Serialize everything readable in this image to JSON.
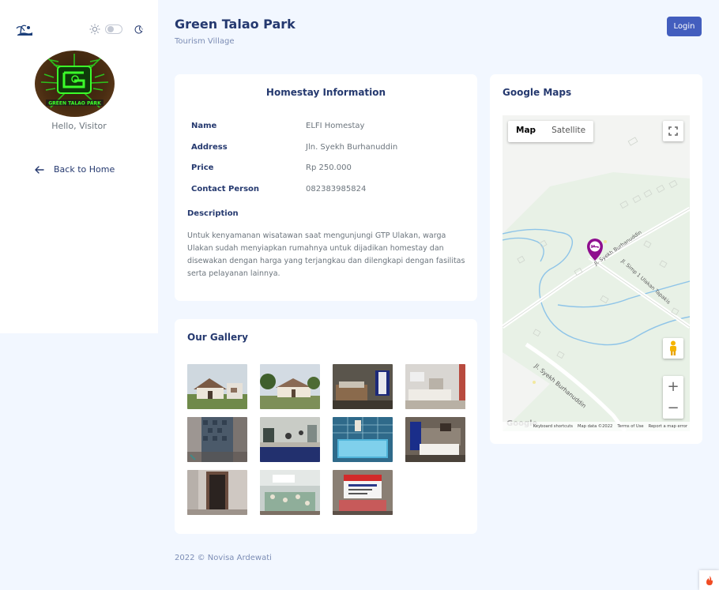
{
  "sidebar": {
    "hello_text": "Hello, Visitor",
    "back_label": "Back to Home",
    "logo_text": "GREEN TALAO PARK"
  },
  "header": {
    "title": "Green Talao Park",
    "subtitle": "Tourism Village",
    "login_label": "Login"
  },
  "homestay": {
    "card_title": "Homestay Information",
    "rows": [
      {
        "key": "Name",
        "value": "ELFI Homestay"
      },
      {
        "key": "Address",
        "value": "Jln. Syekh Burhanuddin"
      },
      {
        "key": "Price",
        "value": "Rp 250.000"
      },
      {
        "key": "Contact Person",
        "value": "082383985824"
      }
    ],
    "description_label": "Description",
    "description": "Untuk kenyamanan wisatawan saat mengunjungi GTP Ulakan, warga Ulakan sudah menyiapkan rumahnya untuk dijadikan homestay dan disewakan dengan harga yang terjangkau dan dilengkapi dengan fasilitas serta pelayanan lainnya."
  },
  "gallery": {
    "title": "Our Gallery",
    "images": [
      "house-front-1",
      "house-front-2",
      "bedroom-1",
      "bedroom-2",
      "wall-tiles",
      "kitchen",
      "bathroom-tiles",
      "bedroom-3",
      "hallway",
      "dining-table",
      "homestay-banner"
    ]
  },
  "map": {
    "title": "Google Maps",
    "tab_map": "Map",
    "tab_satellite": "Satellite",
    "road_labels": [
      "Jl. Syekh Burhanuddin",
      "Jl. Simp 1 Ulakan Tapakis",
      "Jl. Syekh Burhanuddin"
    ],
    "footer_links": [
      "Keyboard shortcuts",
      "Map data ©2022",
      "Terms of Use",
      "Report a map error"
    ],
    "google_logo": "Google"
  },
  "footer": {
    "text": "2022 © Novisa Ardewati"
  },
  "colors": {
    "primary": "#435ebe",
    "heading": "#25396f",
    "background": "#f2f7ff",
    "map_pin": "#8e0e8e"
  }
}
